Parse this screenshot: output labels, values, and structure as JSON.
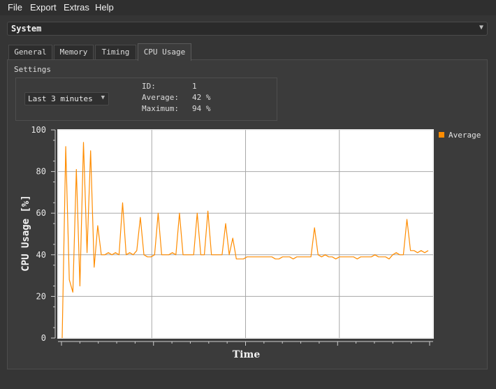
{
  "menu": [
    "File",
    "Export",
    "Extras",
    "Help"
  ],
  "system_select": {
    "value": "System"
  },
  "tabs": [
    {
      "label": "General",
      "active": false
    },
    {
      "label": "Memory",
      "active": false
    },
    {
      "label": "Timing",
      "active": false
    },
    {
      "label": "CPU Usage",
      "active": true
    }
  ],
  "settings": {
    "title": "Settings",
    "range": "Last 3 minutes",
    "stats": [
      {
        "label": "ID:",
        "value": "1"
      },
      {
        "label": "Average:",
        "value": "42 %"
      },
      {
        "label": "Maximum:",
        "value": "94 %"
      }
    ]
  },
  "colors": {
    "series": "#ff8c00",
    "plot_bg": "#ffffff",
    "grid": "#a8a8a8"
  },
  "chart_data": {
    "type": "line",
    "xlabel": "Time",
    "ylabel": "CPU Usage [%]",
    "ylim": [
      0,
      100
    ],
    "yticks": [
      0,
      20,
      40,
      60,
      80,
      100
    ],
    "grid": true,
    "legend_placement": "right",
    "series": [
      {
        "name": "Average",
        "values": [
          0,
          92,
          28,
          22,
          81,
          25,
          94,
          41,
          90,
          34,
          54,
          40,
          40,
          41,
          40,
          41,
          40,
          65,
          40,
          41,
          40,
          42,
          58,
          40,
          39,
          39,
          40,
          60,
          40,
          40,
          40,
          41,
          40,
          60,
          40,
          40,
          40,
          40,
          60,
          40,
          40,
          61,
          40,
          40,
          40,
          40,
          55,
          40,
          48,
          38,
          38,
          38,
          39,
          39,
          39,
          39,
          39,
          39,
          39,
          39,
          38,
          38,
          39,
          39,
          39,
          38,
          39,
          39,
          39,
          39,
          39,
          53,
          40,
          39,
          40,
          39,
          39,
          38,
          39,
          39,
          39,
          39,
          39,
          38,
          39,
          39,
          39,
          39,
          40,
          39,
          39,
          39,
          38,
          40,
          41,
          40,
          40,
          57,
          42,
          42,
          41,
          42,
          41,
          42
        ]
      }
    ]
  }
}
